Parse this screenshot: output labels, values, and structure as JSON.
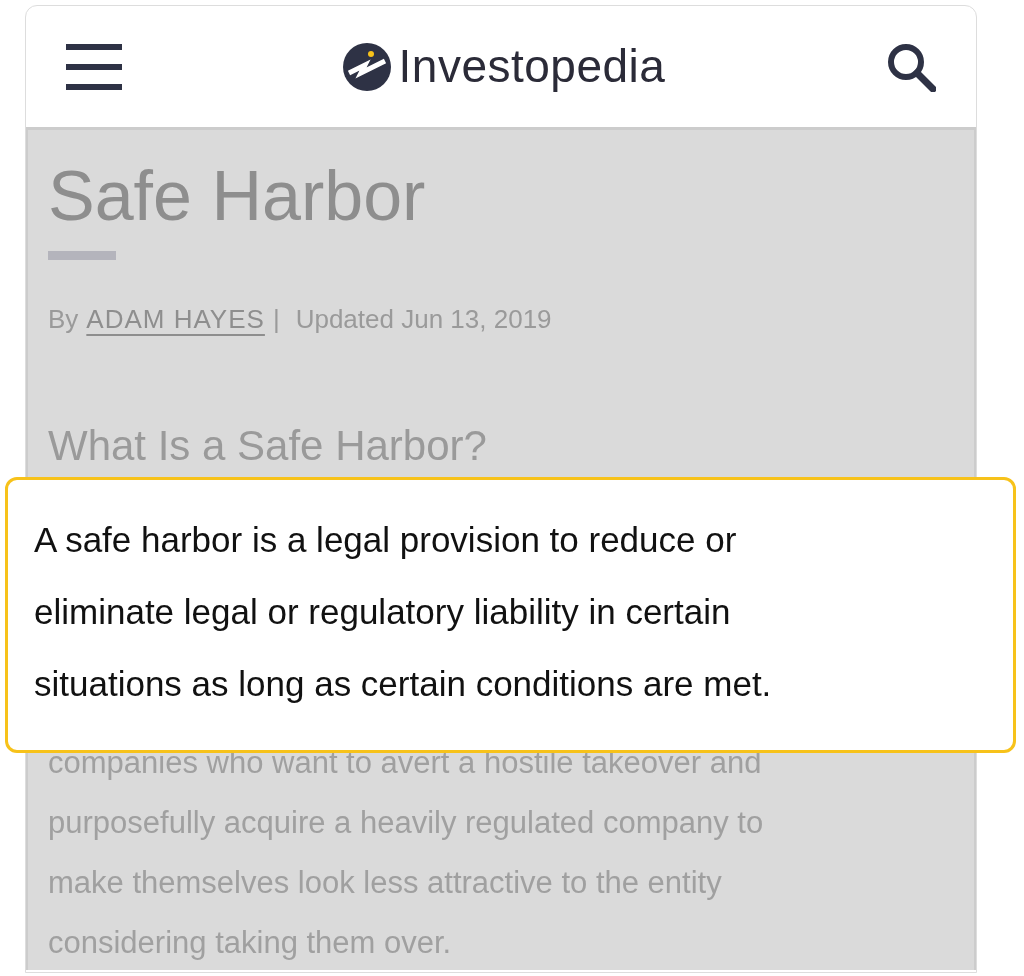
{
  "header": {
    "brand": "Investopedia"
  },
  "article": {
    "title": "Safe Harbor",
    "byline_prefix": "By",
    "author": "ADAM HAYES",
    "separator": "|",
    "updated": "Updated Jun 13, 2019",
    "heading": "What Is a Safe Harbor?",
    "paragraph_lines": [
      "companies who want to avert a hostile takeover and",
      "purposefully acquire a heavily regulated company to",
      "make themselves look less attractive to the entity",
      "considering taking them over."
    ]
  },
  "callout": {
    "lines": [
      "A safe harbor is a legal provision to reduce or",
      "eliminate legal or regulatory liability in certain",
      "situations as long as certain conditions are met."
    ]
  }
}
